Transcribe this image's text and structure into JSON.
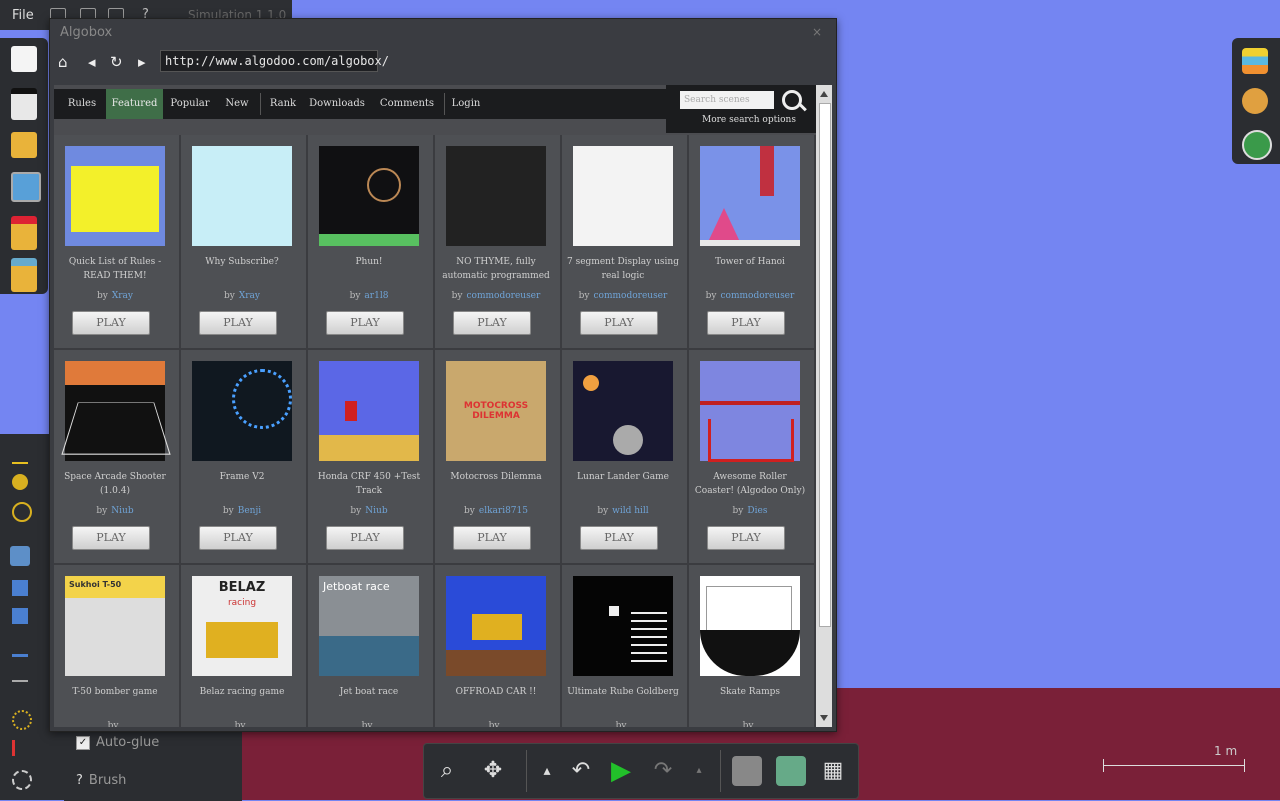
{
  "menubar": {
    "file_label": "File",
    "scene_label": "Simulation 1 1.0"
  },
  "bottom_panel": {
    "autoglue_label": "Auto-glue",
    "brush_label": "Brush",
    "help_glyph": "?"
  },
  "window": {
    "title": "Algobox",
    "close_glyph": "×",
    "url": "http://www.algodoo.com/algobox/",
    "nav": {
      "home": "⌂",
      "back": "◂",
      "reload": "↻",
      "forward": "▸"
    }
  },
  "tabs": [
    {
      "label": "Rules",
      "active": false
    },
    {
      "label": "Featured",
      "active": true
    },
    {
      "label": "Popular",
      "active": false
    },
    {
      "label": "New",
      "active": false
    },
    {
      "label": "Rank",
      "active": false
    },
    {
      "label": "Downloads",
      "active": false
    },
    {
      "label": "Comments",
      "active": false
    },
    {
      "label": "Login",
      "active": false
    }
  ],
  "search": {
    "placeholder": "Search scenes",
    "more_options": "More search options"
  },
  "play_label": "PLAY",
  "by_label": "by",
  "cards": [
    {
      "title": "Quick List of Rules - READ THEM!",
      "author": "Xray",
      "thumb": "#6f8ae0"
    },
    {
      "title": "Why Subscribe?",
      "author": "Xray",
      "thumb": "#c8eef7"
    },
    {
      "title": "Phun!",
      "author": "ar1l8",
      "thumb": "#101012"
    },
    {
      "title": "NO THYME, fully automatic programmed",
      "author": "commodoreuser",
      "thumb": "#222"
    },
    {
      "title": "7 segment Display using real logic",
      "author": "commodoreuser",
      "thumb": "#f3f3f3"
    },
    {
      "title": "Tower of Hanoi",
      "author": "commodoreuser",
      "thumb": "#7a92e8"
    },
    {
      "title": "Space Arcade Shooter (1.0.4)",
      "author": "Niub",
      "thumb": "#111"
    },
    {
      "title": "Frame V2",
      "author": "Benji",
      "thumb": "#101820"
    },
    {
      "title": "Honda CRF 450 +Test Track",
      "author": "Niub",
      "thumb": "#5b67e6"
    },
    {
      "title": "Motocross Dilemma",
      "author": "elkari8715",
      "thumb": "#c9a86d"
    },
    {
      "title": "Lunar Lander Game",
      "author": "wild hill",
      "thumb": "#181830"
    },
    {
      "title": "Awesome Roller Coaster! (Algodoo Only)",
      "author": "Dies",
      "thumb": "#7e86e0"
    },
    {
      "title": "T-50 bomber game",
      "author": "",
      "thumb": "#f3d34a"
    },
    {
      "title": "Belaz racing game",
      "author": "",
      "thumb": "#eeeeee"
    },
    {
      "title": "Jet boat race",
      "author": "",
      "thumb": "#8a8f94"
    },
    {
      "title": "OFFROAD CAR !!",
      "author": "",
      "thumb": "#2a4bd8"
    },
    {
      "title": "Ultimate Rube Goldberg",
      "author": "",
      "thumb": "#050505"
    },
    {
      "title": "Skate Ramps",
      "author": "",
      "thumb": "#ffffff"
    }
  ],
  "thumb_texts": {
    "belaz": "BELAZ",
    "belaz_sub": "racing",
    "jetboat": "Jetboat race",
    "sukhoi": "Sukhoi T-50",
    "motocross": "MOTOCROSS DILEMMA"
  },
  "toolbar": {
    "zoom": "⌕",
    "pan": "✥",
    "undo": "↶",
    "play": "▶",
    "redo": "↷",
    "grid": "▦",
    "up_small": "▴",
    "down_small": "▴"
  },
  "scale": {
    "label": "1 m"
  },
  "colors": {
    "sky": "#7485f2",
    "ground": "#7a2038",
    "active_tab": "#3f6e48",
    "author_link": "#6fa3d6",
    "play_icon": "#22c02a"
  }
}
